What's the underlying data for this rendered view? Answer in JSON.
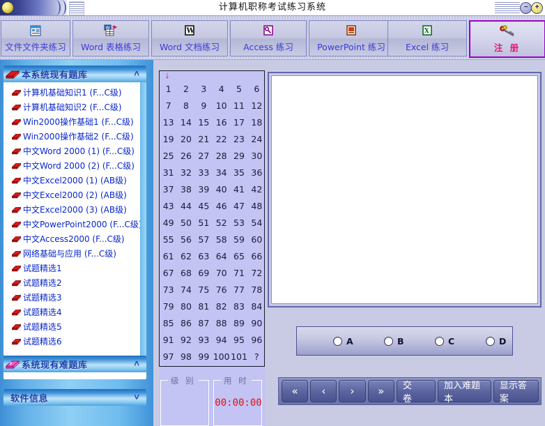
{
  "window": {
    "title": "计算机职称考试练习系统",
    "minimize_label": "−",
    "maximize_label": "+"
  },
  "toolbar": {
    "items": [
      {
        "label": "文件文件夹练习",
        "icon": "folder-file-icon",
        "active": false
      },
      {
        "label": "Word 表格练习",
        "icon": "word-table-icon",
        "active": false
      },
      {
        "label": "Word 文档练习",
        "icon": "word-doc-icon",
        "active": false
      },
      {
        "label": "Access 练习",
        "icon": "access-key-icon",
        "active": false
      },
      {
        "label": "PowerPoint 练习",
        "icon": "powerpoint-icon",
        "active": false
      },
      {
        "label": "Excel 练习",
        "icon": "excel-icon",
        "active": false
      },
      {
        "label": "注 册",
        "icon": "keys-icon",
        "active": true
      }
    ]
  },
  "sidebar": {
    "bank_panel": {
      "title": "本系统现有题库",
      "icon": "red-book-icon",
      "chevron": "˄",
      "items": [
        {
          "label": "计算机基础知识1 (F...C级)",
          "icon": "red-book-small-icon"
        },
        {
          "label": "计算机基础知识2 (F...C级)",
          "icon": "red-book-small-icon"
        },
        {
          "label": "Win2000操作基础1 (F...C级)",
          "icon": "red-book-small-icon"
        },
        {
          "label": "Win2000操作基础2 (F...C级)",
          "icon": "red-book-small-icon"
        },
        {
          "label": "中文Word 2000 (1) (F...C级)",
          "icon": "red-book-small-icon"
        },
        {
          "label": "中文Word 2000 (2) (F...C级)",
          "icon": "red-book-small-icon"
        },
        {
          "label": "中文Excel2000 (1) (AB级)",
          "icon": "red-book-small-icon"
        },
        {
          "label": "中文Excel2000 (2) (AB级)",
          "icon": "red-book-small-icon"
        },
        {
          "label": "中文Excel2000 (3) (AB级)",
          "icon": "red-book-small-icon"
        },
        {
          "label": "中文PowerPoint2000 (F...C级)",
          "icon": "red-book-small-icon"
        },
        {
          "label": "中文Access2000 (F...C级)",
          "icon": "red-book-small-icon"
        },
        {
          "label": "网络基础与应用 (F...C级)",
          "icon": "red-book-small-icon"
        },
        {
          "label": "试题精选1",
          "icon": "red-book-small-icon"
        },
        {
          "label": "试题精选2",
          "icon": "red-book-small-icon"
        },
        {
          "label": "试题精选3",
          "icon": "red-book-small-icon"
        },
        {
          "label": "试题精选4",
          "icon": "red-book-small-icon"
        },
        {
          "label": "试题精选5",
          "icon": "red-book-small-icon"
        },
        {
          "label": "试题精选6",
          "icon": "red-book-small-icon"
        }
      ]
    },
    "hard_panel": {
      "title": "系统现有难题库",
      "icon": "pink-question-book-icon",
      "chevron": "˄",
      "items": []
    },
    "info_panel": {
      "title": "软件信息",
      "chevron": "˅"
    }
  },
  "question_numbers": {
    "cells": [
      "1",
      "2",
      "3",
      "4",
      "5",
      "6",
      "7",
      "8",
      "9",
      "10",
      "11",
      "12",
      "13",
      "14",
      "15",
      "16",
      "17",
      "18",
      "19",
      "20",
      "21",
      "22",
      "23",
      "24",
      "25",
      "26",
      "27",
      "28",
      "29",
      "30",
      "31",
      "32",
      "33",
      "34",
      "35",
      "36",
      "37",
      "38",
      "39",
      "40",
      "41",
      "42",
      "43",
      "44",
      "45",
      "46",
      "47",
      "48",
      "49",
      "50",
      "51",
      "52",
      "53",
      "54",
      "55",
      "56",
      "57",
      "58",
      "59",
      "60",
      "61",
      "62",
      "63",
      "64",
      "65",
      "66",
      "67",
      "68",
      "69",
      "70",
      "71",
      "72",
      "73",
      "74",
      "75",
      "76",
      "77",
      "78",
      "79",
      "80",
      "81",
      "82",
      "83",
      "84",
      "85",
      "86",
      "87",
      "88",
      "89",
      "90",
      "91",
      "92",
      "93",
      "94",
      "95",
      "96",
      "97",
      "98",
      "99",
      "100",
      "101",
      "?"
    ],
    "current_marker": "↓",
    "current_index": 1
  },
  "status": {
    "level_label": "级 别",
    "level_value": "",
    "time_label": "用 时",
    "time_value": "00:00:00"
  },
  "answers": {
    "options": [
      {
        "label": "A",
        "selected": false
      },
      {
        "label": "B",
        "selected": false
      },
      {
        "label": "C",
        "selected": false
      },
      {
        "label": "D",
        "selected": false
      }
    ]
  },
  "buttons": {
    "first": "«",
    "prev": "‹",
    "next": "›",
    "last": "»",
    "submit": "交 卷",
    "add_hard": "加入难题本",
    "show_answer": "显示答案"
  },
  "question_area": {
    "content": ""
  },
  "colors": {
    "accent_blue": "#3a3ad8",
    "register_pink": "#e0187a",
    "register_border": "#9b00c8",
    "sidebar_blue": "#8fd0f5",
    "timer_red": "#e11010",
    "grid_bg": "#c3c3f4",
    "button_bar": "#6a73ab"
  }
}
